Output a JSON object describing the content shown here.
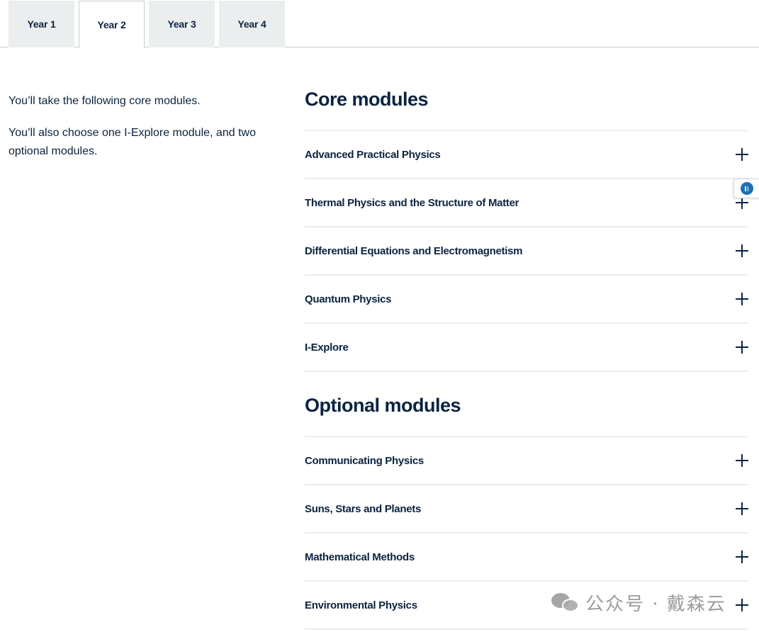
{
  "tabs": [
    {
      "label": "Year 1"
    },
    {
      "label": "Year 2"
    },
    {
      "label": "Year 3"
    },
    {
      "label": "Year 4"
    }
  ],
  "active_tab": "Year 2",
  "intro": {
    "line1": "You’ll take the following core modules.",
    "line2": "You’ll also choose one I-Explore module, and two optional modules."
  },
  "core": {
    "title": "Core modules",
    "items": [
      {
        "label": "Advanced Practical Physics"
      },
      {
        "label": "Thermal Physics and the Structure of Matter"
      },
      {
        "label": "Differential Equations and Electromagnetism"
      },
      {
        "label": "Quantum Physics"
      },
      {
        "label": "I-Explore"
      }
    ]
  },
  "optional": {
    "title": "Optional modules",
    "items": [
      {
        "label": "Communicating Physics"
      },
      {
        "label": "Suns, Stars and Planets"
      },
      {
        "label": "Mathematical Methods"
      },
      {
        "label": "Environmental Physics"
      }
    ]
  },
  "watermark": {
    "text": "公众号 · 戴森云"
  },
  "icons": {
    "expand": "plus-icon",
    "widget": "pause-icon",
    "watermark": "wechat-icon"
  },
  "colors": {
    "text": "#0b2340",
    "tab_bg": "#ebeeee",
    "divider": "#e9ecee",
    "accent": "#1e6fb3"
  }
}
